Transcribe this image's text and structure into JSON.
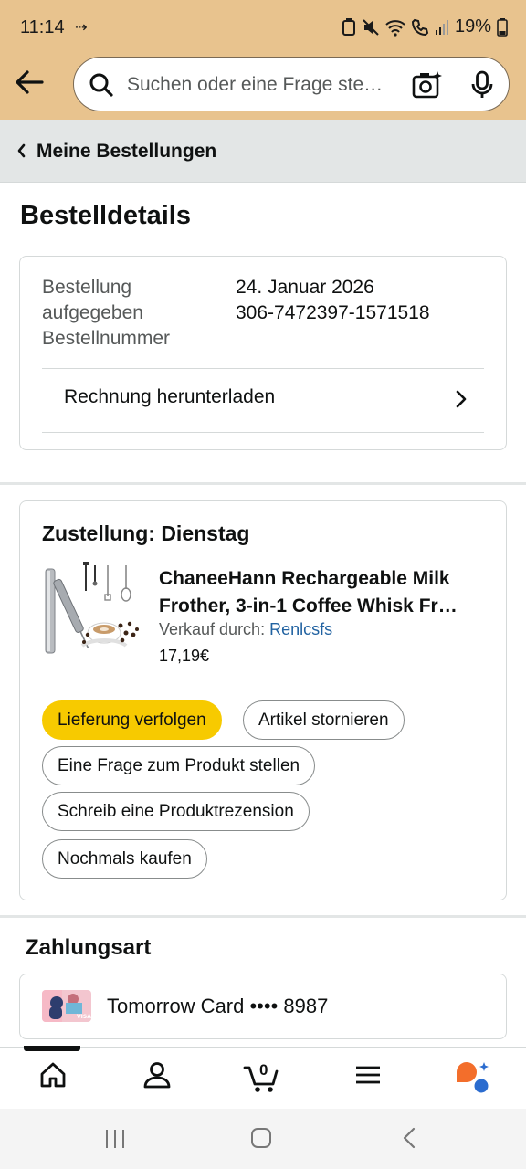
{
  "status_bar": {
    "time": "11:14",
    "battery": "19%"
  },
  "search": {
    "placeholder": "Suchen oder eine Frage ste…"
  },
  "breadcrumb": {
    "label": "Meine Bestellungen"
  },
  "page_title": "Bestelldetails",
  "order_info": {
    "placed_label": "Bestellung aufgegeben",
    "placed_label_line1": "Bestellung",
    "placed_label_line2": "aufgegeben",
    "placed_value": "24. Januar 2026",
    "number_label": "Bestellnummer",
    "number_value": "306-7472397-1571518",
    "invoice_label": "Rechnung herunterladen"
  },
  "delivery": {
    "title": "Zustellung: Dienstag",
    "product": {
      "title_line1": "ChaneeHann Rechargeable Milk",
      "title_line2": "Frother, 3-in-1 Coffee Whisk Fr…",
      "seller_prefix": "Verkauf durch:",
      "seller_name": "Renlcsfs",
      "price": "17,19€"
    },
    "actions": {
      "track": "Lieferung verfolgen",
      "cancel": "Artikel stornieren",
      "question": "Eine Frage zum Produkt stellen",
      "review": "Schreib eine Produktrezension",
      "buy_again": "Nochmals kaufen"
    }
  },
  "payment": {
    "title": "Zahlungsart",
    "card_text": "Tomorrow Card •••• 8987"
  },
  "bottom_nav": {
    "cart_count": "0",
    "items": [
      "home-icon",
      "account-icon",
      "cart-icon",
      "menu-icon",
      "assistant-icon"
    ]
  },
  "colors": {
    "header_bg": "#e8c38e",
    "primary_button": "#f7ca00",
    "link": "#2162a1",
    "breadcrumb_bg": "#e3e6e6"
  }
}
